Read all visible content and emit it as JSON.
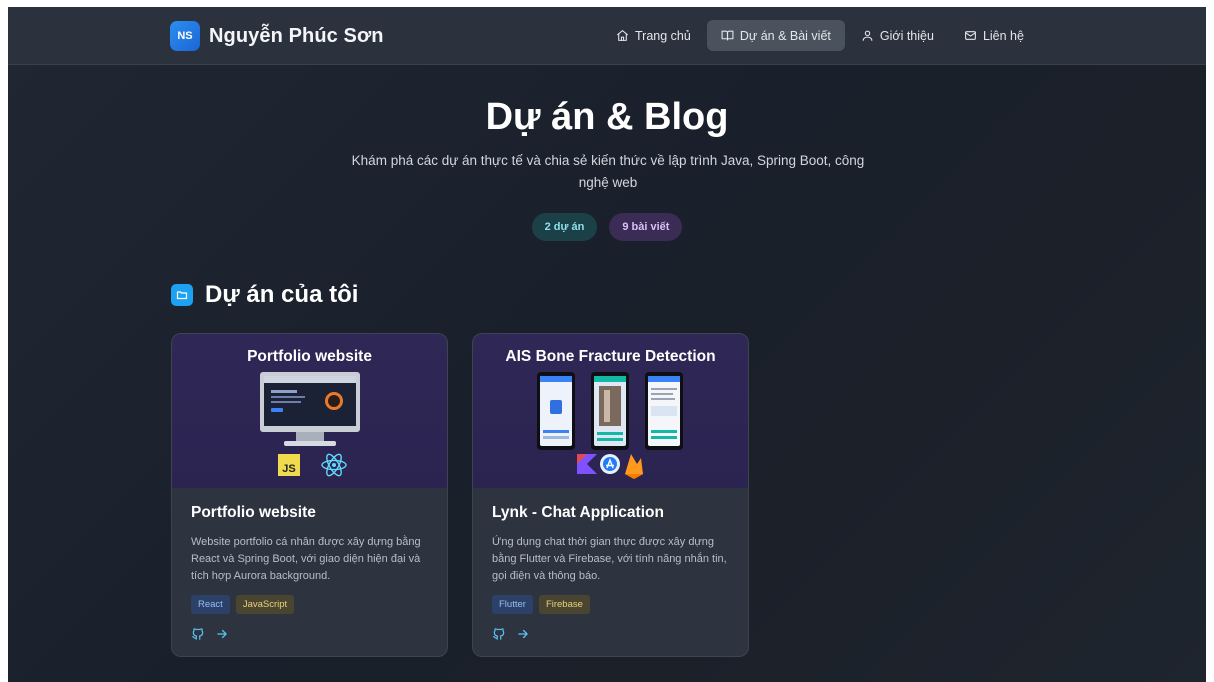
{
  "brand": {
    "initials": "NS",
    "name": "Nguyễn Phúc Sơn"
  },
  "nav": [
    {
      "label": "Trang chủ",
      "icon": "home-icon",
      "active": false
    },
    {
      "label": "Dự án & Bài viết",
      "icon": "book-icon",
      "active": true
    },
    {
      "label": "Giới thiệu",
      "icon": "user-icon",
      "active": false
    },
    {
      "label": "Liên hệ",
      "icon": "mail-icon",
      "active": false
    }
  ],
  "hero": {
    "title": "Dự án & Blog",
    "subtitle": "Khám phá các dự án thực tế và chia sẻ kiến thức về lập trình Java, Spring Boot, công nghệ web",
    "projects_pill": "2 dự án",
    "posts_pill": "9 bài viết"
  },
  "projects_section": {
    "title": "Dự án của tôi",
    "cards": [
      {
        "thumb_title": "Portfolio website",
        "title": "Portfolio website",
        "description": "Website portfolio cá nhân được xây dựng bằng React và Spring Boot, với giao diện hiện đại và tích hợp Aurora background.",
        "tags": [
          "React",
          "JavaScript"
        ],
        "tech_icons": [
          "JS"
        ]
      },
      {
        "thumb_title": "AIS Bone Fracture Detection",
        "title": "Lynk - Chat Application",
        "description": "Ứng dụng chat thời gian thực được xây dựng bằng Flutter và Firebase, với tính năng nhắn tin, gọi điện và thông báo.",
        "tags": [
          "Flutter",
          "Firebase"
        ]
      }
    ]
  },
  "colors": {
    "accent": "#1da1f2",
    "nav_active": "#4a525e",
    "card_bg": "#2d343f",
    "thumb_bg": "#2f2856"
  }
}
